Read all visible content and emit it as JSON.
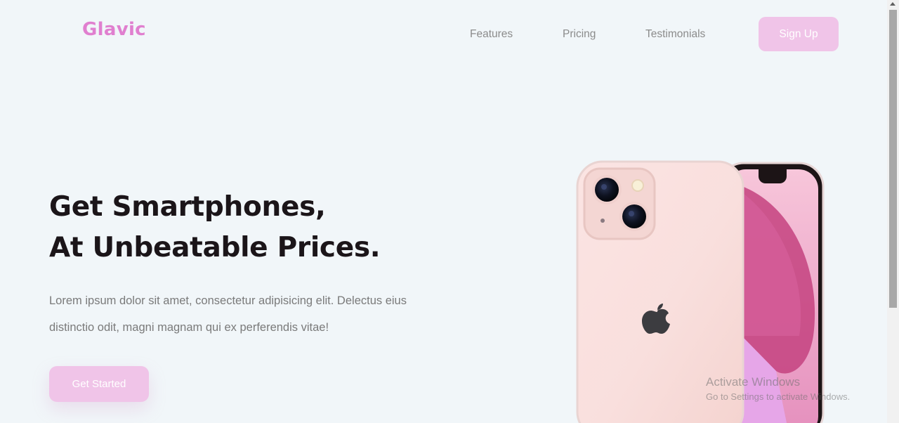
{
  "header": {
    "logo": "Glavic",
    "nav": [
      "Features",
      "Pricing",
      "Testimonials"
    ],
    "signup_label": "Sign Up"
  },
  "hero": {
    "headline_line1": "Get Smartphones,",
    "headline_line2": "At Unbeatable Prices.",
    "description": "Lorem ipsum dolor sit amet, consectetur adipisicing elit. Delectus eius distinctio odit, magni magnam qui ex perferendis vitae!",
    "cta_label": "Get Started"
  },
  "watermark": {
    "line1": "Activate Windows",
    "line2": "Go to Settings to activate Windows."
  },
  "colors": {
    "background": "#f1f6f9",
    "brand": "#e07fcf",
    "button": "#f0c4e8",
    "heading": "#1b1519",
    "body_text": "#7a7a7a"
  },
  "icons": [
    "apple-logo-icon",
    "scroll-up-arrow-icon"
  ]
}
